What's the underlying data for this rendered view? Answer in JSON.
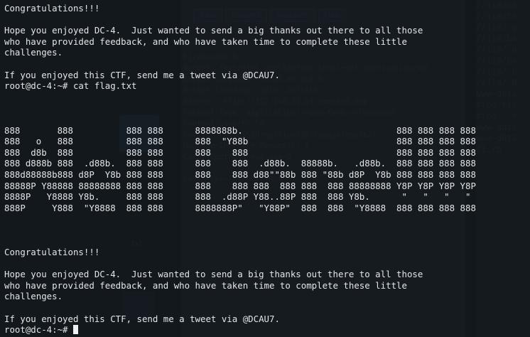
{
  "background_window": {
    "tabs": [
      "Raw",
      "Params",
      "Headers",
      "Hex"
    ],
    "request_lines": [
      "",
      "Firefox/60.0",
      "Accept: text/html,application/xhtml+xml,application/xml",
      "Accept-Language: en-US,en;q=0.5",
      "Accept-Encoding: gzip, deflate",
      "Referer: http://192.168.31.54/command.php",
      "Content-Type: application/x-www-form-urlencoded",
      "Content-Length: 56",
      "Cookie: PHPSESSID=ng9fjuc390fhbadge7aeb8b24",
      "Upgrade-Insecure-Requests: 1",
      "Cache-Control: max-age=0",
      "",
      "radio=ls+-l&submit=Run"
    ],
    "right_lines": [
      "//jim/mb",
      "//jim/te",
      "//jim/.p",
      "//jim/ba",
      "//jim/.p",
      "//jim/ba",
      "//jim/.b",
      "//jim/.b",
      "www-data",
      "find fla",
      "find: 'f",
      "www-data",
      "www-data",
      "f1.rb"
    ],
    "icon_label": ".txt"
  },
  "terminal": {
    "lines": [
      "Congratulations!!!",
      "",
      "Hope you enjoyed DC-4.  Just wanted to send a big thanks out there to all those",
      "who have provided feedback, and who have taken time to complete these little",
      "challenges.",
      "",
      "If you enjoyed this CTF, send me a tweet via @DCAU7.",
      "root@dc-4:~# cat flag.txt",
      "",
      "",
      "",
      "888       888          888 888      8888888b.                             888 888 888 888",
      "888   o   888          888 888      888  \"Y88b                            888 888 888 888",
      "888  d8b  888          888 888      888    888                            888 888 888 888",
      "888 d888b 888  .d88b.  888 888      888    888  .d88b.  88888b.   .d88b.  888 888 888 888",
      "888d88888b888 d8P  Y8b 888 888      888    888 d88\"\"88b 888 \"88b d8P  Y8b 888 888 888 888",
      "88888P Y88888 88888888 888 888      888    888 888  888 888  888 88888888 Y8P Y8P Y8P Y8P",
      "8888P   Y8888 Y8b.     888 888      888  .d88P Y88..88P 888  888 Y8b.      \"   \"   \"   \"",
      "888P     Y888  \"Y8888  888 888      8888888P\"   \"Y88P\"  888  888  \"Y8888  888 888 888 888",
      "",
      "",
      "",
      "Congratulations!!!",
      "",
      "Hope you enjoyed DC-4.  Just wanted to send a big thanks out there to all those",
      "who have provided feedback, and who have taken time to complete these little",
      "challenges.",
      "",
      "If you enjoyed this CTF, send me a tweet via @DCAU7."
    ],
    "prompt": "root@dc-4:~# "
  }
}
